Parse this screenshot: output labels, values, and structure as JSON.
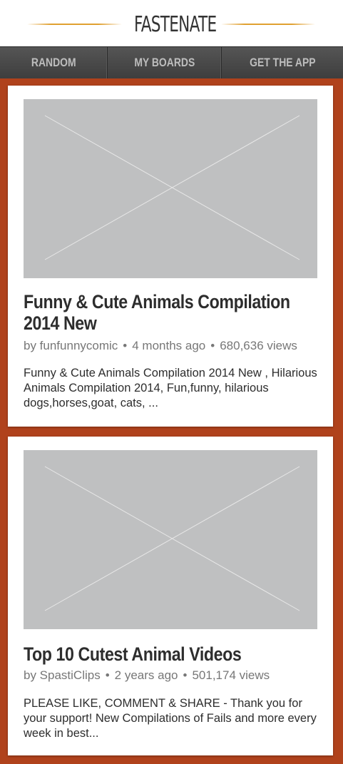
{
  "header": {
    "logo_text": "FASTENATE",
    "accent_color": "#e0a030",
    "pin_color": "#c0441c"
  },
  "nav": {
    "items": [
      {
        "label": "RANDOM"
      },
      {
        "label": "MY BOARDS"
      },
      {
        "label": "GET THE APP"
      }
    ]
  },
  "videos": [
    {
      "title": "Funny & Cute Animals Compilation 2014 New",
      "author": "by funfunnycomic",
      "age": "4 months ago",
      "views": "680,636 views",
      "description": "Funny & Cute Animals Compilation 2014 New , Hilarious Animals Compilation 2014, Fun,funny, hilarious dogs,horses,goat, cats, ...",
      "thumbnail_icon": "placeholder-image-icon"
    },
    {
      "title": "Top 10 Cutest Animal Videos",
      "author": "by SpastiClips",
      "age": "2 years ago",
      "views": "501,174 views",
      "description": "PLEASE LIKE, COMMENT & SHARE - Thank you for your support! New Compilations of Fails and more every week in best...",
      "thumbnail_icon": "placeholder-image-icon"
    }
  ],
  "separator": "•"
}
